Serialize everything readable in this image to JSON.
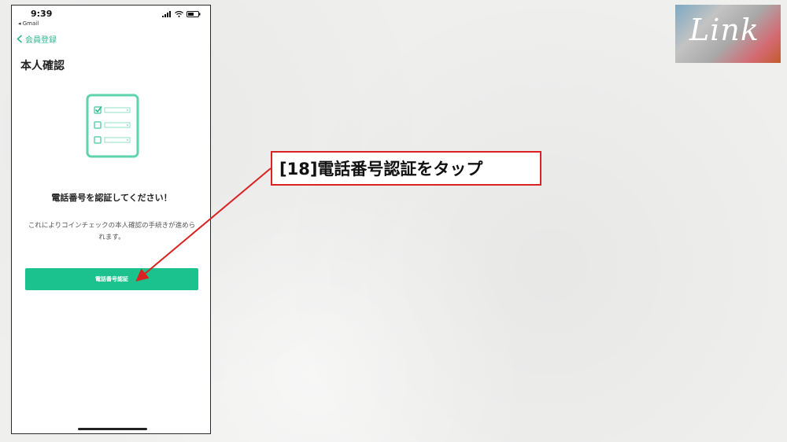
{
  "status_bar": {
    "time": "9:39",
    "back_app": "◂ Gmail"
  },
  "nav": {
    "back_label": "会員登録"
  },
  "page": {
    "title": "本人確認",
    "heading": "電話番号を認証してください！",
    "description": "これによりコインチェックの本人確認の手続きが進められます。",
    "button_label": "電話番号認証"
  },
  "annotation": {
    "callout": "[18]電話番号認証をタップ"
  },
  "logo": {
    "text": "Link"
  },
  "colors": {
    "accent": "#1cc28e",
    "callout_border": "#d92222",
    "nav_green": "#2fb68b"
  }
}
